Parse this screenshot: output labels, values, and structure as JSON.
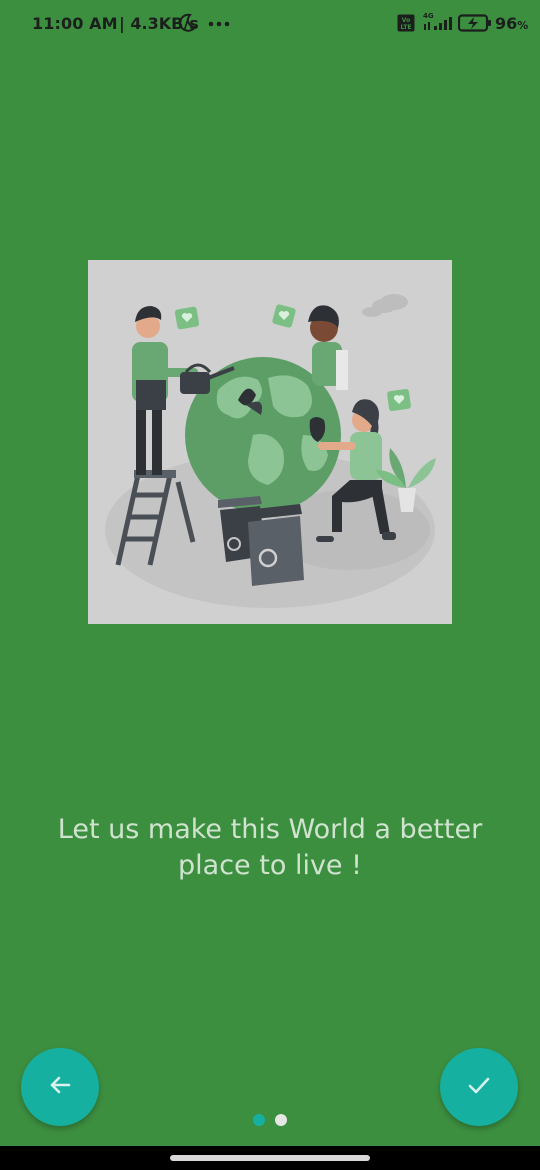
{
  "status_bar": {
    "time": "11:00 AM",
    "network_speed": "| 4.3KB/s",
    "icons": [
      "moon-icon",
      "more-dots-icon",
      "volte-icon",
      "4g-signal-icon",
      "battery-charging-icon"
    ],
    "network_type": "4G",
    "battery_value": "96",
    "battery_unit": "%"
  },
  "slide": {
    "illustration": "people-caring-for-planet-earth-illustration",
    "tagline": "Let us make this World a better place to live !"
  },
  "navigation": {
    "back_button_icon": "arrow-left-icon",
    "done_button_icon": "checkmark-icon",
    "page_count": 2,
    "current_page": 1
  },
  "colors": {
    "background": "#3d8f40",
    "accent": "#16b0a0",
    "tagline_text": "#cfe3cf",
    "illustration_bg": "#d0d0d0"
  }
}
